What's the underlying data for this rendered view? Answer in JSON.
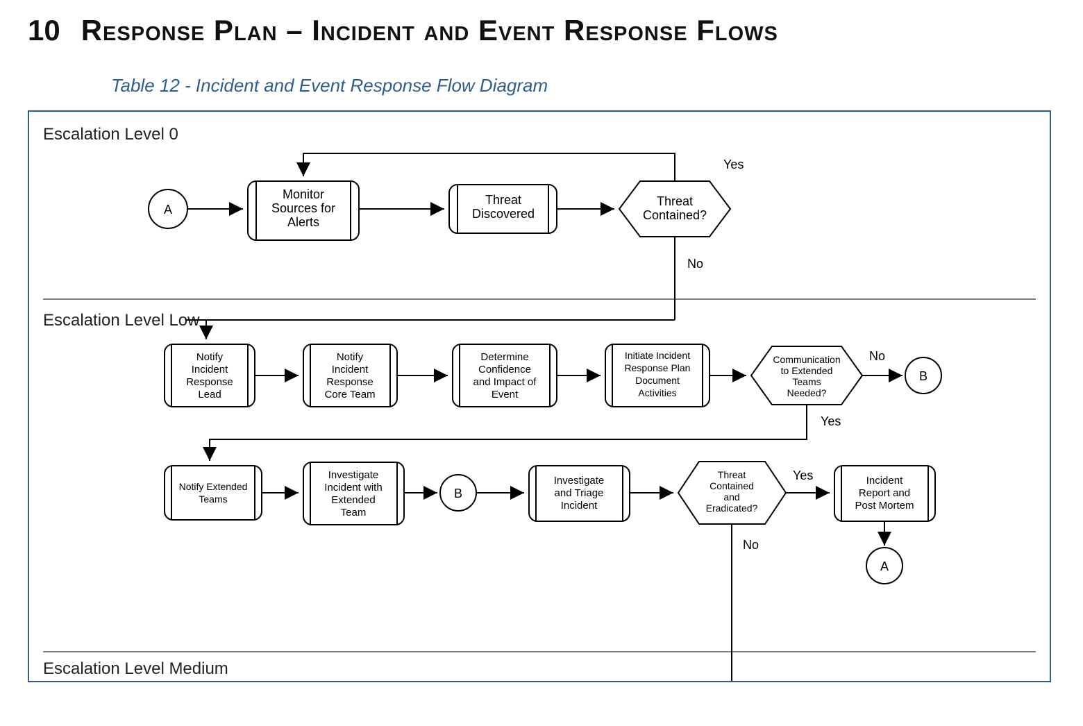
{
  "section_number": "10",
  "section_title": "Response Plan – Incident and Event Response Flows",
  "caption": "Table 12 - Incident and Event Response Flow Diagram",
  "lanes": {
    "level0": "Escalation Level 0",
    "low": "Escalation Level Low",
    "medium": "Escalation Level Medium"
  },
  "nodes": {
    "A": "A",
    "monitor": "Monitor Sources for Alerts",
    "threat_discovered": "Threat Discovered",
    "threat_contained_q": "Threat Contained?",
    "notify_lead": "Notify Incident Response Lead",
    "notify_core": "Notify Incident Response Core Team",
    "determine": "Determine Confidence and Impact of Event",
    "initiate": "Initiate Incident Response Plan Document Activities",
    "comm_needed_q": "Communication to Extended Teams Needed?",
    "B_top": "B",
    "notify_extended": "Notify Extended Teams",
    "investigate_extended": "Investigate Incident with Extended Team",
    "B_mid": "B",
    "investigate_triage": "Investigate and Triage Incident",
    "contained_eradicated_q": "Threat Contained and Eradicated?",
    "report": "Incident Report and Post Mortem",
    "A_end": "A"
  },
  "labels": {
    "yes0": "Yes",
    "no0": "No",
    "yes1": "Yes",
    "no1": "No",
    "yes2": "Yes",
    "no2": "No"
  }
}
